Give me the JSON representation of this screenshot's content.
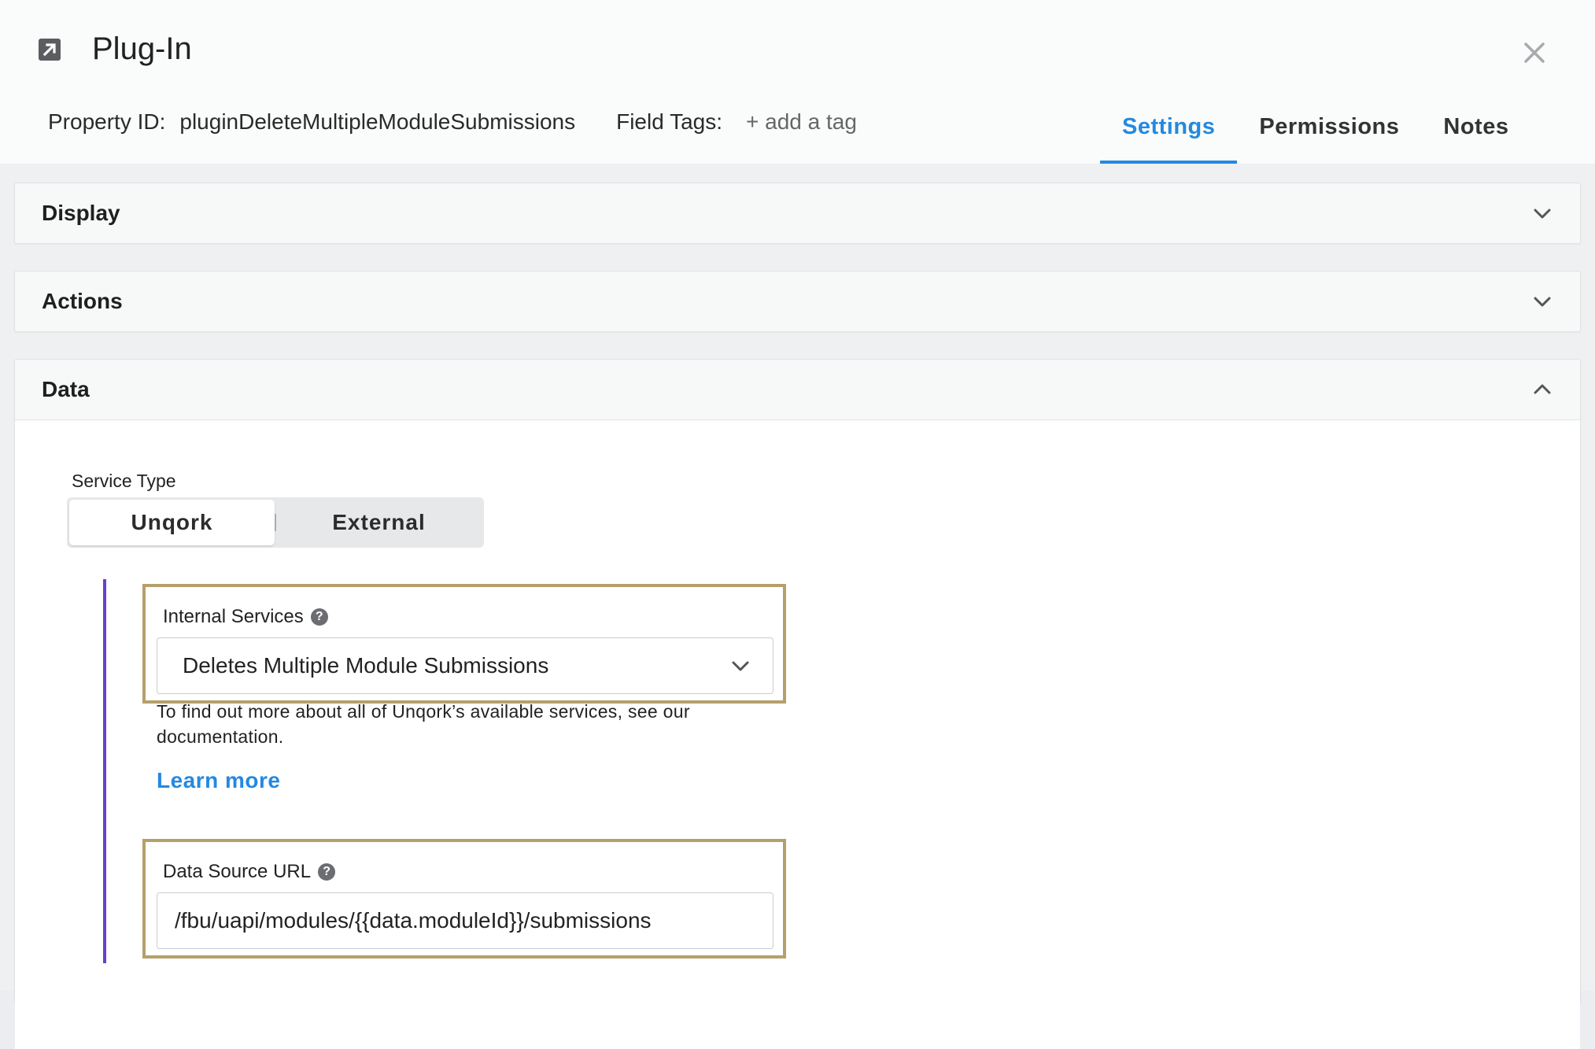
{
  "modal": {
    "title": "Plug-In",
    "property_id_label": "Property ID:",
    "property_id_value": "pluginDeleteMultipleModuleSubmissions",
    "field_tags_label": "Field Tags:",
    "add_tag_label": "+ add a tag",
    "tabs": [
      {
        "label": "Settings",
        "active": true
      },
      {
        "label": "Permissions",
        "active": false
      },
      {
        "label": "Notes",
        "active": false
      }
    ]
  },
  "sections": {
    "display": {
      "title": "Display",
      "expanded": false
    },
    "actions": {
      "title": "Actions",
      "expanded": false
    },
    "data": {
      "title": "Data",
      "expanded": true
    }
  },
  "data_section": {
    "service_type_label": "Service Type",
    "service_type_options": [
      "Unqork",
      "External"
    ],
    "service_type_selected": "Unqork",
    "internal_services_label": "Internal Services",
    "internal_services_value": "Deletes Multiple Module Submissions",
    "help_text": "To find out more about all of Unqork’s available services, see our documentation.",
    "learn_more_label": "Learn more",
    "data_source_url_label": "Data Source URL",
    "data_source_url_value": "/fbu/uapi/modules/{{data.moduleId}}/submissions"
  },
  "colors": {
    "accent": "#2489e0",
    "highlight_border": "#b5a06a",
    "left_bar": "#6a3fcf"
  }
}
